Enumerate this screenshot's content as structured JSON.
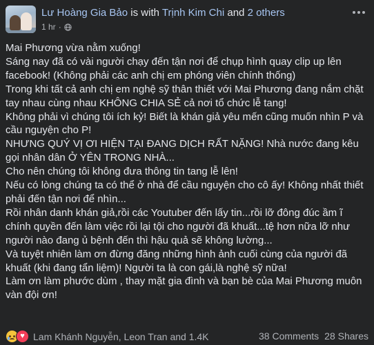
{
  "post": {
    "author": "Lư Hoàng Gia Bảo",
    "with_text": "is with",
    "tagged": "Trịnh Kim Chi",
    "and_text": "and",
    "others": "2 others",
    "time": "1 hr",
    "dot": "·",
    "lines": [
      "Mai Phương vừa nằm xuống!",
      "Sáng nay đã có vài người chạy đến tận nơi để chụp hình quay clip up lên facebook! (Không phải các anh chị em phóng viên chính thống)",
      "Trong khi tất cả anh chị em nghệ sỹ thân thiết với Mai Phương đang nắm chặt tay nhau cùng nhau KHÔNG CHIA SẺ cả nơi tổ chức lễ tang!",
      "Không phải vì chúng tôi ích kỷ! Biết là khán giả yêu mến cũng muốn nhìn P và cầu nguyện cho P!",
      "NHƯNG QUÝ VỊ ƠI HIỆN TẠI ĐANG DỊCH RẤT NẶNG! Nhà nước đang kêu gọi nhân dân Ở YÊN TRONG NHÀ...",
      "Cho nên chúng tôi không đưa thông tin tang lễ lên!",
      "Nếu có lòng chúng ta có thể ở nhà để cầu nguyện cho cô ấy! Không nhất thiết phải đến tận nơi để nhìn...",
      "Rồi nhân danh khán giả,rồi các Youtuber đến lấy tin...rồi lỡ đông đúc ầm ĩ chính quyền đến làm việc rồi lại tội cho người đã khuất...tệ hơn nữa lỡ như người nào đang ủ bệnh đến thì hậu quả sẽ không lường...",
      "Và tuyệt nhiên làm ơn đừng đăng những hình ảnh cuối cùng của người đã khuất (khi đang tẩn liệm)! Người ta là con gái,là nghệ sỹ nữa!",
      "Làm ơn làm phước dùm , thay mặt gia đình và bạn bè của Mai Phương muôn vàn đội ơn!"
    ]
  },
  "footer": {
    "reactions": [
      "sad-icon",
      "love-icon"
    ],
    "reaction_names": "Lam Khánh Nguyễn, Leon Tran and 1.4K",
    "comments": "38 Comments",
    "shares": "28 Shares"
  },
  "colors": {
    "background": "#242526",
    "text": "#e4e6eb",
    "secondary": "#b0b3b8",
    "link": "#a8c6f2"
  }
}
